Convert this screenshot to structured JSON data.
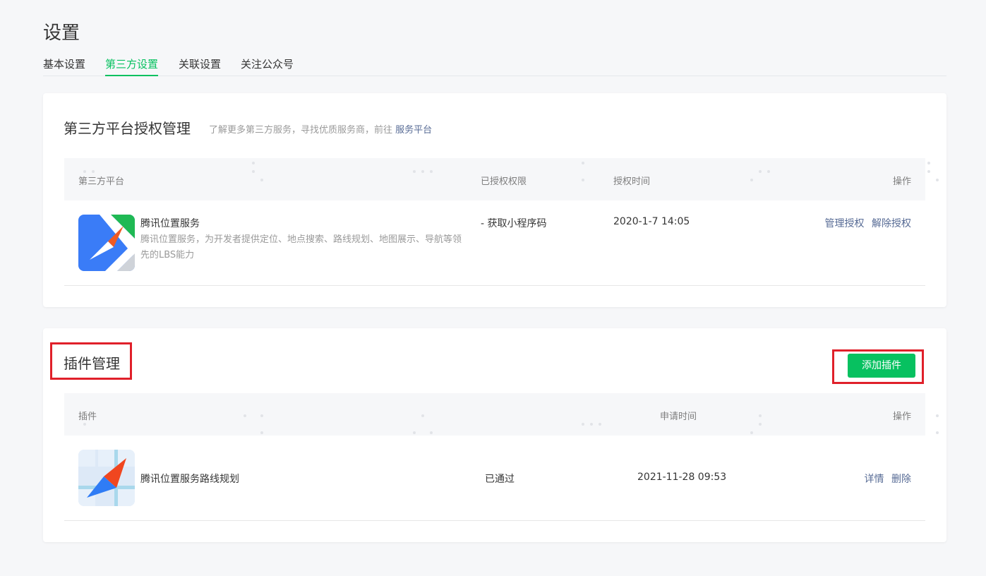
{
  "page": {
    "title": "设置"
  },
  "tabs": [
    {
      "label": "基本设置"
    },
    {
      "label": "第三方设置",
      "active": true
    },
    {
      "label": "关联设置"
    },
    {
      "label": "关注公众号"
    }
  ],
  "auth_card": {
    "title": "第三方平台授权管理",
    "desc": "了解更多第三方服务，寻找优质服务商，前往",
    "desc_link": "服务平台",
    "columns": {
      "platform": "第三方平台",
      "permission": "已授权权限",
      "time": "授权时间",
      "action": "操作"
    },
    "rows": [
      {
        "logo": "tencent-location-service-logo",
        "name": "腾讯位置服务",
        "desc": "腾讯位置服务，为开发者提供定位、地点搜索、路线规划、地图展示、导航等领先的LBS能力",
        "permission": "- 获取小程序码",
        "time": "2020-1-7 14:05",
        "actions": [
          "管理授权",
          "解除授权"
        ]
      }
    ]
  },
  "plugin_card": {
    "title": "插件管理",
    "add_button": "添加插件",
    "columns": {
      "plugin": "插件",
      "time": "申请时间",
      "action": "操作"
    },
    "rows": [
      {
        "logo": "route-planning-plugin-logo",
        "name": "腾讯位置服务路线规划",
        "status": "已通过",
        "time": "2021-11-28 09:53",
        "actions": [
          "详情",
          "删除"
        ]
      }
    ]
  },
  "colors": {
    "accent": "#07c160",
    "link": "#576b95",
    "highlight": "#e0202a",
    "background": "#f6f7f9"
  }
}
